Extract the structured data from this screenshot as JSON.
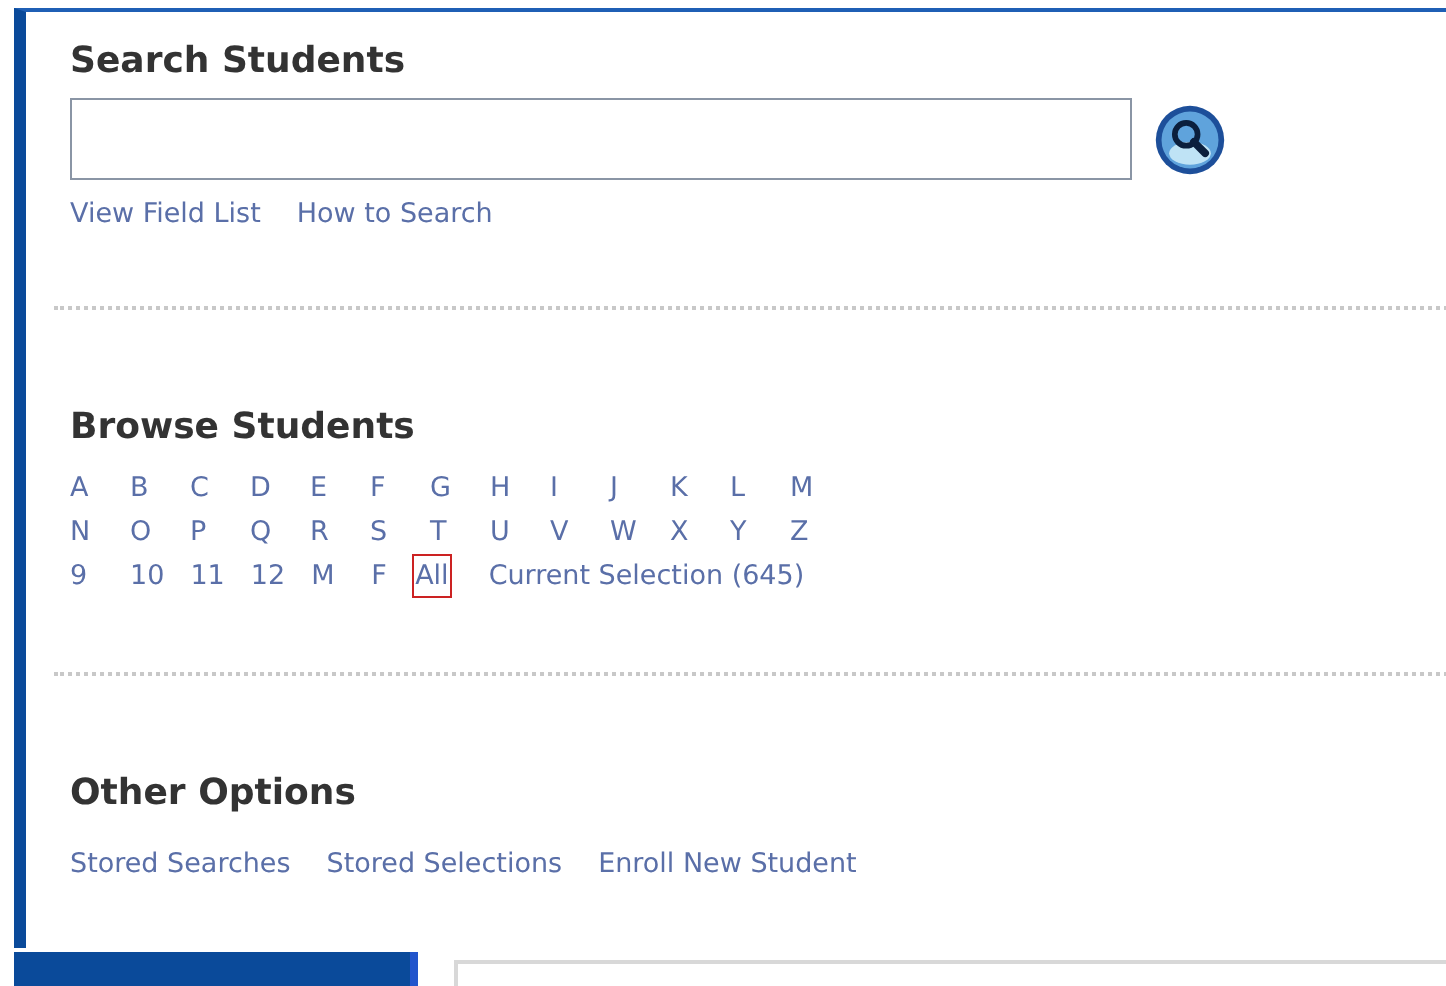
{
  "search": {
    "heading": "Search Students",
    "links": [
      "View Field List",
      "How to Search"
    ]
  },
  "browse": {
    "heading": "Browse Students",
    "rows": [
      [
        {
          "label": "A",
          "selected": false
        },
        {
          "label": "B",
          "selected": false
        },
        {
          "label": "C",
          "selected": false
        },
        {
          "label": "D",
          "selected": false
        },
        {
          "label": "E",
          "selected": false
        },
        {
          "label": "F",
          "selected": false
        },
        {
          "label": "G",
          "selected": false
        },
        {
          "label": "H",
          "selected": false
        },
        {
          "label": "I",
          "selected": false
        },
        {
          "label": "J",
          "selected": false
        },
        {
          "label": "K",
          "selected": false
        },
        {
          "label": "L",
          "selected": false
        },
        {
          "label": "M",
          "selected": false
        }
      ],
      [
        {
          "label": "N",
          "selected": false
        },
        {
          "label": "O",
          "selected": false
        },
        {
          "label": "P",
          "selected": false
        },
        {
          "label": "Q",
          "selected": false
        },
        {
          "label": "R",
          "selected": false
        },
        {
          "label": "S",
          "selected": false
        },
        {
          "label": "T",
          "selected": false
        },
        {
          "label": "U",
          "selected": false
        },
        {
          "label": "V",
          "selected": false
        },
        {
          "label": "W",
          "selected": false
        },
        {
          "label": "X",
          "selected": false
        },
        {
          "label": "Y",
          "selected": false
        },
        {
          "label": "Z",
          "selected": false
        }
      ],
      [
        {
          "label": "9",
          "selected": false
        },
        {
          "label": "10",
          "selected": false
        },
        {
          "label": "11",
          "selected": false
        },
        {
          "label": "12",
          "selected": false
        },
        {
          "label": "M",
          "selected": false
        },
        {
          "label": "F",
          "selected": false
        },
        {
          "label": "All",
          "selected": true
        }
      ]
    ],
    "current_selection": "Current Selection (645)"
  },
  "other": {
    "heading": "Other Options",
    "links": [
      "Stored Searches",
      "Stored Selections",
      "Enroll New Student"
    ]
  }
}
